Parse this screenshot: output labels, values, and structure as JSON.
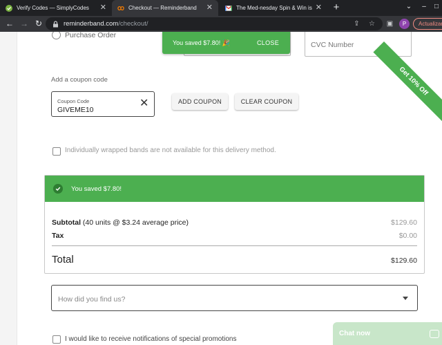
{
  "browser": {
    "tabs": [
      {
        "title": "Verify Codes — SimplyCodes",
        "icon": "simplycodes-check-icon"
      },
      {
        "title": "Checkout — Reminderband",
        "icon": "reminderband-icon"
      },
      {
        "title": "The Med-nesday Spin & Win is live!",
        "icon": "gmail-icon"
      }
    ],
    "url_host": "reminderband.com",
    "url_path": "/checkout/",
    "profile_initial": "P",
    "update_label": "Actualizar"
  },
  "form": {
    "purchase_order_label": "Purchase Order",
    "cvc_placeholder": "CVC Number",
    "coupon_heading": "Add a coupon code",
    "coupon_field_label": "Coupon Code",
    "coupon_value": "GIVEME10",
    "add_coupon_label": "ADD COUPON",
    "clear_coupon_label": "CLEAR COUPON",
    "wrapped_bands_label": "Individually wrapped bands are not available for this delivery method.",
    "referral_placeholder": "How did you find us?",
    "notifications_label": "I would like to receive notifications of special promotions"
  },
  "toast": {
    "message": "You saved $7.80! 🎉",
    "close_label": "CLOSE"
  },
  "ribbon_text": "Get 10% Off",
  "summary": {
    "saved_message": "You saved $7.80!",
    "subtotal_label": "Subtotal",
    "subtotal_detail": " (40 units @ $3.24 average price)",
    "subtotal_value": "$129.60",
    "tax_label": "Tax",
    "tax_value": "$0.00",
    "total_label": "Total",
    "total_value": "$129.60"
  },
  "chat": {
    "label": "Chat now"
  },
  "colors": {
    "accent_green": "#4caf50",
    "toast_green": "#4caf50"
  }
}
